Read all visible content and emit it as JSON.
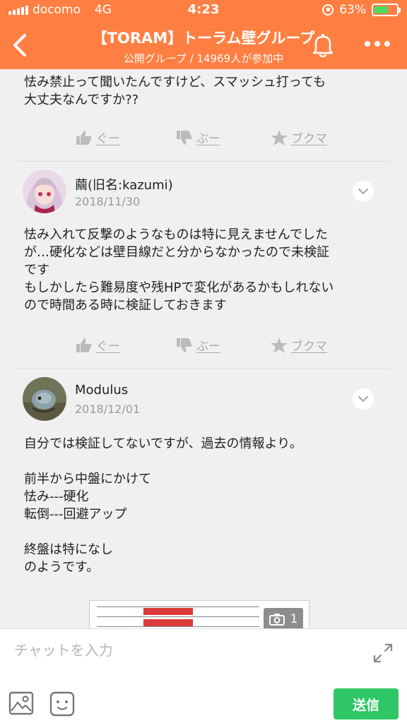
{
  "status_bar": {
    "carrier": "docomo",
    "network": "4G",
    "time": "4:23",
    "battery_pct": "63%",
    "battery_level": 0.63
  },
  "header": {
    "title": "【TORAM】トーラム壁グループ",
    "subtitle": "公開グループ / 14969人が参加中"
  },
  "reaction_labels": {
    "good": "ぐー",
    "boo": "ぶー",
    "bookmark": "ブクマ"
  },
  "messages": [
    {
      "text": "怯み禁止って聞いたんですけど、スマッシュ打っても\n大丈夫なんですか??"
    },
    {
      "username": "繭(旧名:kazumi)",
      "date": "2018/11/30",
      "text": "怯み入れて反撃のようなものは特に見えませんでした\nが…硬化などは壁目線だと分からなかったので未検証\nです\nもしかしたら難易度や残HPで変化があるかもしれない\nので時間ある時に検証しておきます"
    },
    {
      "username": "Modulus",
      "date": "2018/12/01",
      "text": "自分では検証してないですが、過去の情報より。\n\n前半から中盤にかけて\n怯み---硬化\n転倒---回避アップ\n\n終盤は特になし\nのようです。",
      "attachment_count": "1"
    }
  ],
  "input": {
    "placeholder": "チャットを入力",
    "value": "",
    "send_label": "送信"
  },
  "colors": {
    "header": "#ff7f42",
    "send": "#2fc765",
    "battery": "#4cd964"
  }
}
